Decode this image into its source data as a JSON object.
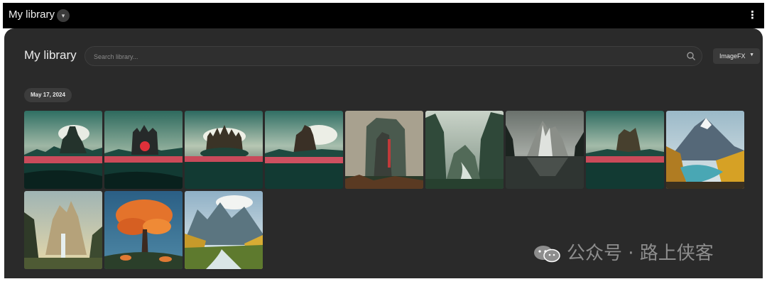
{
  "topbar": {
    "title": "My library"
  },
  "library": {
    "title": "My library",
    "search_placeholder": "Search library...",
    "source_select": "ImageFX",
    "date_group": "May 17, 2024"
  },
  "thumbnails": [
    {
      "theme": "castle-swamp"
    },
    {
      "theme": "castle-swamp-red-gate"
    },
    {
      "theme": "castle-spires"
    },
    {
      "theme": "castle-swamp"
    },
    {
      "theme": "stone-ruin-tower"
    },
    {
      "theme": "misty-valley-river"
    },
    {
      "theme": "dark-mountain-lake"
    },
    {
      "theme": "castle-swamp"
    },
    {
      "theme": "autumn-mountain-lake"
    },
    {
      "theme": "fantasy-cliff-waterfall"
    },
    {
      "theme": "orange-tree"
    },
    {
      "theme": "autumn-valley-river"
    }
  ],
  "watermark": {
    "text": "公众号 · 路上侠客"
  },
  "colors": {
    "topbar_bg": "#000000",
    "panel_bg": "#2a2a2a",
    "chip_bg": "#3c3c3c"
  }
}
